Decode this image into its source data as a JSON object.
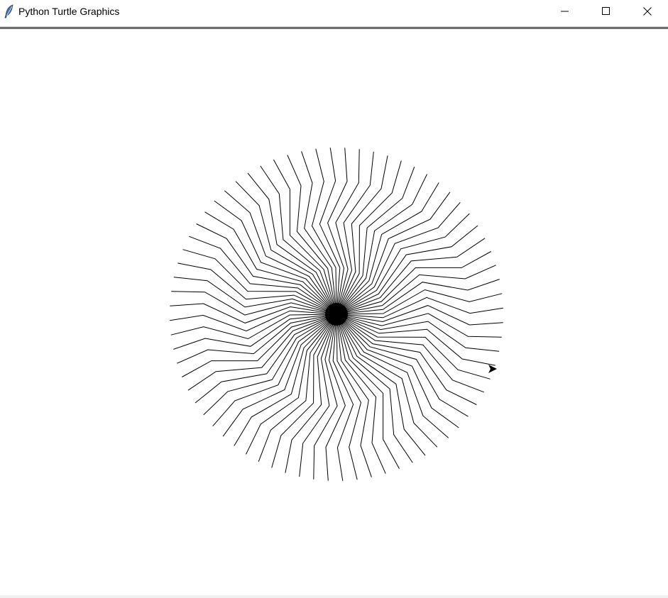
{
  "window": {
    "title": "Python Turtle Graphics",
    "icon": "feather-icon",
    "controls": [
      "minimize-icon",
      "maximize-icon",
      "close-icon"
    ]
  },
  "canvas": {
    "background": "#ffffff",
    "pen_color": "#000000",
    "turtle_shape": "classic-arrow"
  }
}
